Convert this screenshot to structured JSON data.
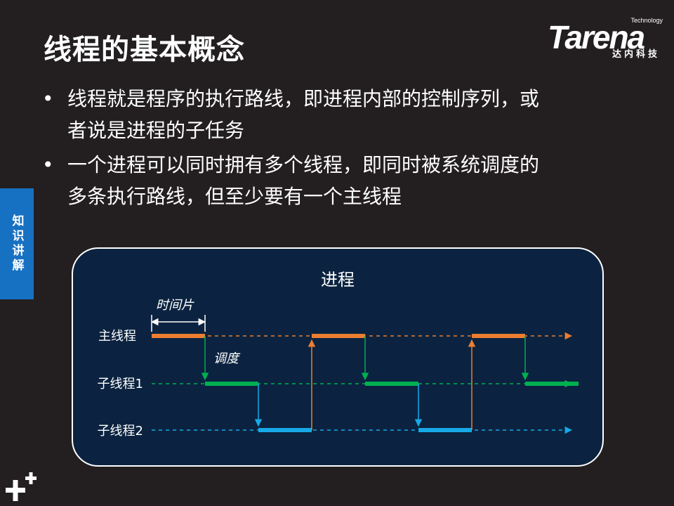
{
  "slide": {
    "title": "线程的基本概念",
    "side_tab": "知识讲解"
  },
  "logo": {
    "brand": "Tarena",
    "tagline": "Technology",
    "subtitle": "达内科技"
  },
  "bullets": [
    {
      "symbol": "•",
      "line1": "线程就是程序的执行路线，即进程内部的控制序列，或",
      "line2": "者说是进程的子任务"
    },
    {
      "symbol": "•",
      "line1": "一个进程可以同时拥有多个线程，即同时被系统调度的",
      "line2": "多条执行路线，但至少要有一个主线程"
    }
  ],
  "diagram": {
    "title": "进程",
    "slice_label": "时间片",
    "schedule_label": "调度",
    "threads": [
      {
        "name": "主线程",
        "color": "#ed7d31"
      },
      {
        "name": "子线程1",
        "color": "#00b050"
      },
      {
        "name": "子线程2",
        "color": "#17a9e8"
      }
    ],
    "timeline": [
      "主线程",
      "子线程1",
      "子线程2",
      "主线程",
      "子线程1",
      "子线程2",
      "主线程",
      "子线程1"
    ]
  },
  "colors": {
    "background": "#231f20",
    "side_tab": "#1771c3",
    "diagram_bg": "#0b2340"
  },
  "icons": {
    "corner": "plus-plus-icon"
  }
}
